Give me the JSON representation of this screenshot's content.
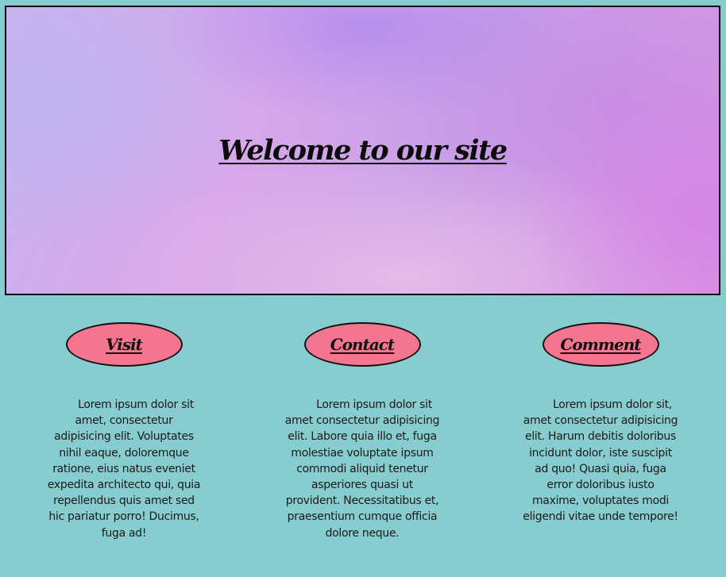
{
  "hero": {
    "title": "Welcome to our site"
  },
  "columns": [
    {
      "button_label": "Visit",
      "text": "Lorem ipsum dolor sit amet, consectetur adipisicing elit. Voluptates nihil eaque, doloremque ratione, eius natus eveniet expedita architecto qui, quia repellendus quis amet sed hic pariatur porro! Ducimus, fuga ad!"
    },
    {
      "button_label": "Contact",
      "text": "Lorem ipsum dolor sit amet consectetur adipisicing elit. Labore quia illo et, fuga molestiae voluptate ipsum commodi aliquid tenetur asperiores quasi ut provident. Necessitatibus et, praesentium cumque officia dolore neque."
    },
    {
      "button_label": "Comment",
      "text": "Lorem ipsum dolor sit, amet consectetur adipisicing elit. Harum debitis doloribus incidunt dolor, iste suscipit ad quo! Quasi quia, fuga error doloribus iusto maxime, voluptates modi eligendi vitae unde tempore!"
    }
  ],
  "colors": {
    "page_background": "#87cdcf",
    "button_fill": "#f3758f",
    "border": "#0c0c0c"
  }
}
